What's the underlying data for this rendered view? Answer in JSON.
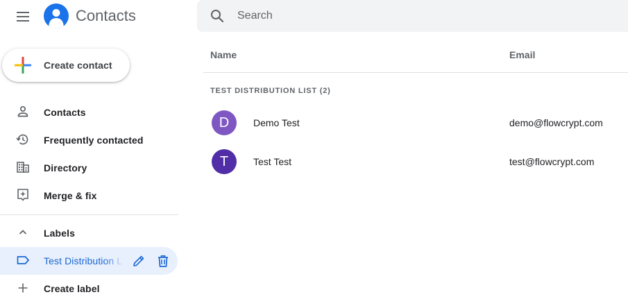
{
  "header": {
    "app_title": "Contacts",
    "search": {
      "placeholder": "Search",
      "value": ""
    }
  },
  "sidebar": {
    "create_contact_label": "Create contact",
    "items": [
      {
        "label": "Contacts",
        "icon": "person-outline-icon"
      },
      {
        "label": "Frequently contacted",
        "icon": "history-icon"
      },
      {
        "label": "Directory",
        "icon": "directory-building-icon"
      },
      {
        "label": "Merge & fix",
        "icon": "merge-fix-icon"
      }
    ],
    "labels_section": {
      "label": "Labels",
      "icon": "chevron-up-icon"
    },
    "labels": [
      {
        "label": "Test Distribution List",
        "icon": "label-outline-icon",
        "active": true
      }
    ],
    "create_label": {
      "label": "Create label",
      "icon": "plus-icon"
    }
  },
  "main": {
    "columns": {
      "name": "Name",
      "email": "Email"
    },
    "group": {
      "title": "TEST DISTRIBUTION LIST (2)"
    },
    "contacts": [
      {
        "initial": "D",
        "name": "Demo Test",
        "email": "demo@flowcrypt.com",
        "avatar_color": "#7e57c2"
      },
      {
        "initial": "T",
        "name": "Test Test",
        "email": "test@flowcrypt.com",
        "avatar_color": "#512da8"
      }
    ]
  },
  "colors": {
    "brand_blue": "#1a73e8",
    "active_bg": "#e8f0fe",
    "active_text": "#1967d2",
    "icon_gray": "#5f6368"
  }
}
